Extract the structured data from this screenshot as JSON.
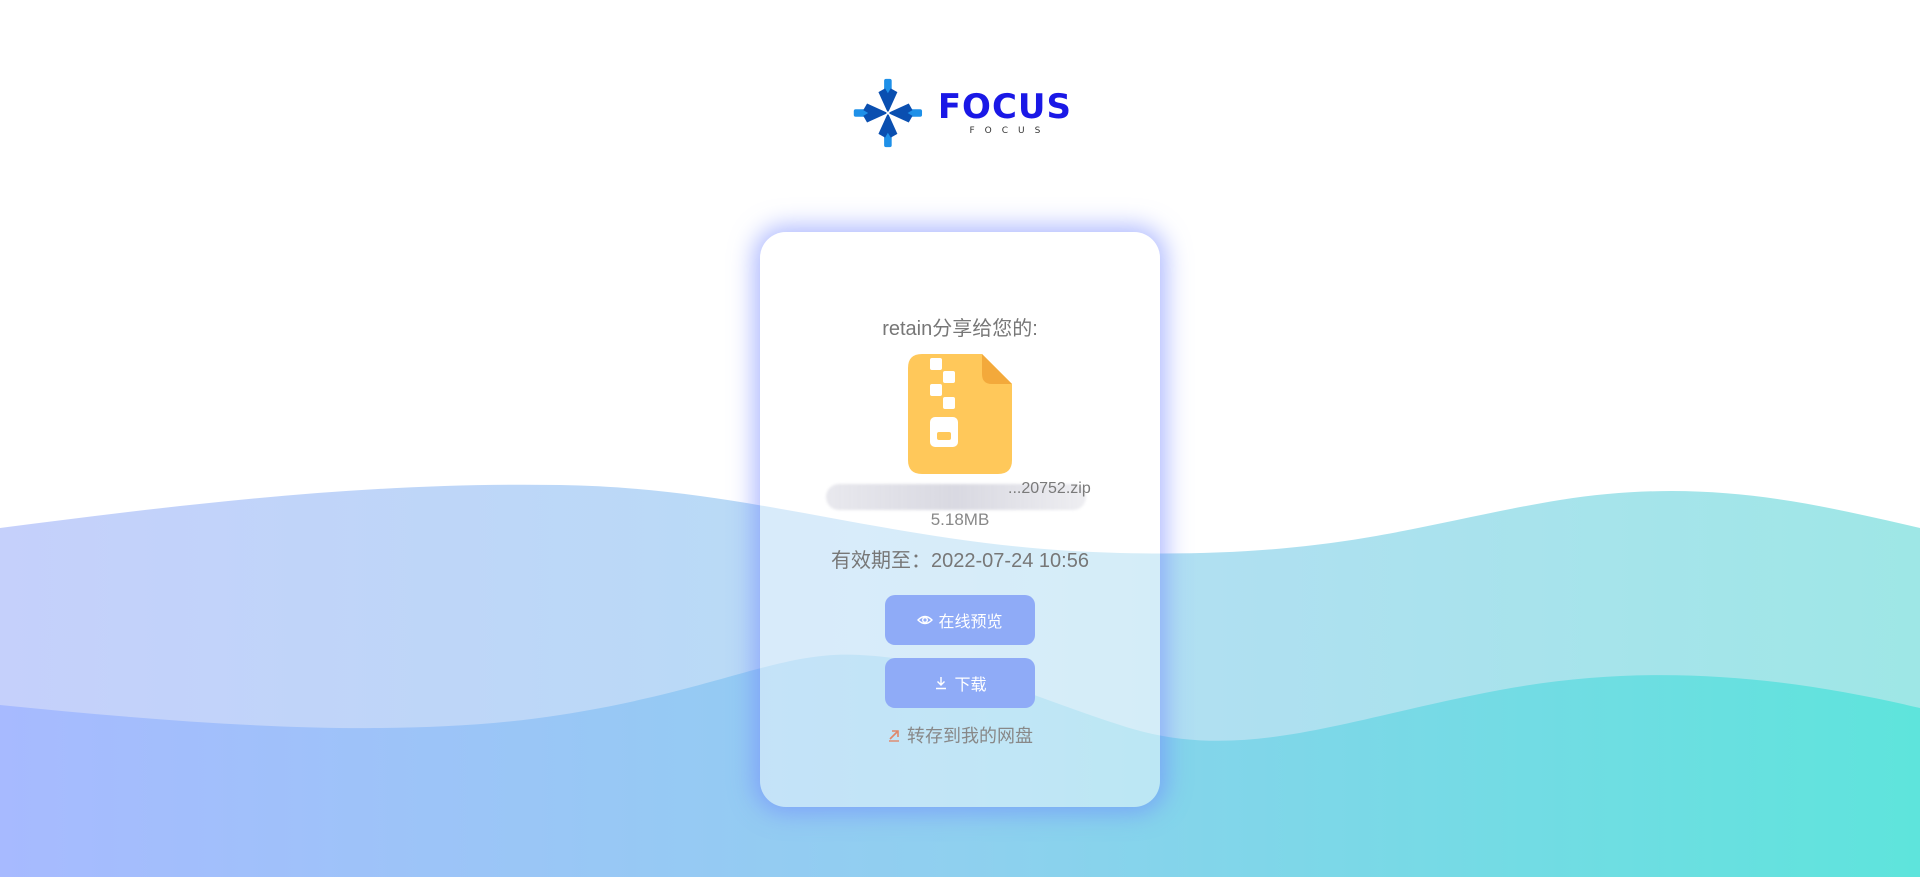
{
  "logo": {
    "word": "FOCUS",
    "sub": "FOCUS"
  },
  "share": {
    "sharer_text": "retain分享给您的:",
    "file_name_visible": "...20752.zip",
    "file_size": "5.18MB",
    "expire_text": "有效期至：2022-07-24 10:56"
  },
  "actions": {
    "preview_label": "在线预览",
    "download_label": "下载",
    "save_label": "转存到我的网盘"
  },
  "icons": {
    "logo": "snowflake-logo-icon",
    "file": "zip-file-icon",
    "preview": "eye-icon",
    "download": "download-icon",
    "save": "external-arrow-icon"
  },
  "colors": {
    "accent_button": "#8fabf7",
    "logo_blue": "#1a18e6",
    "file_icon": "#ffc85a",
    "wave_left": "#a9b8ff",
    "wave_right": "#5ee6dc"
  }
}
